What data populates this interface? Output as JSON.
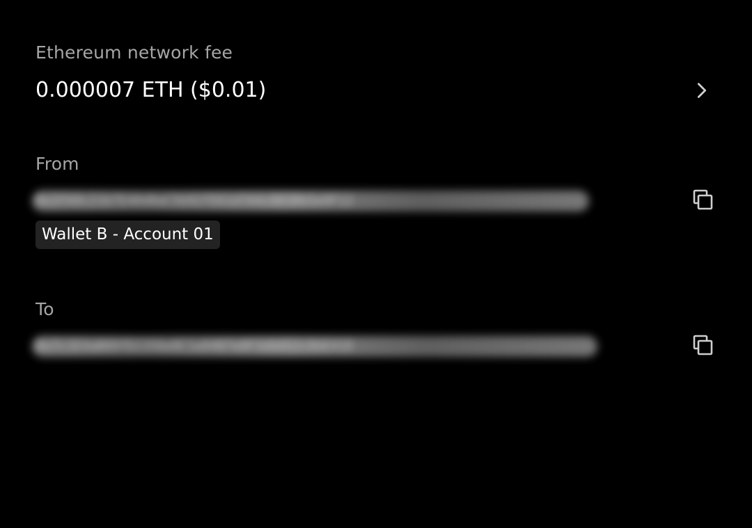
{
  "fee": {
    "label": "Ethereum network fee",
    "value": "0.000007 ETH ($0.01)"
  },
  "from": {
    "label": "From",
    "address": "0x3fA9c21b7E48d0aC5b92fE61d7A4c803Bb5e9F12",
    "account_badge": "Wallet B - Account 01"
  },
  "to": {
    "label": "To",
    "address": "0x7c1E4aB09fD2356e8C1a94B7e0F3d6A52c8bE41D"
  },
  "icons": {
    "fee_chevron": "chevron-right-icon",
    "copy": "copy-icon"
  },
  "colors": {
    "background": "#000000",
    "label": "#a6a6a6",
    "value": "#ffffff",
    "badge_bg": "#232323"
  }
}
